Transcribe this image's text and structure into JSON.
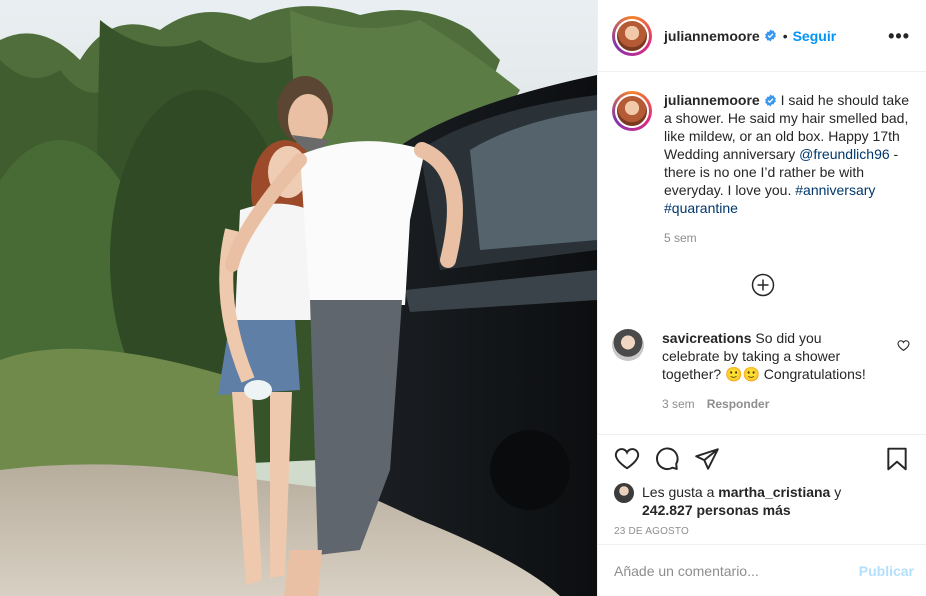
{
  "header": {
    "username": "juliannemoore",
    "separator": "•",
    "follow_label": "Seguir",
    "more_label": "•••"
  },
  "caption": {
    "username": "juliannemoore",
    "text_before": "I said he should take a shower. He said my hair smelled bad, like mildew, or an old box. Happy 17th Wedding anniversary ",
    "mention": "@freundlich96",
    "text_after": " - there is no one I’d rather be with everyday. I love you. ",
    "hashtag1": "#anniversary",
    "hashtag2": "#quarantine",
    "time": "5 sem"
  },
  "comment": {
    "username": "savicreations",
    "text": "So did you celebrate by taking a shower together? 🙂🙂 Congratulations!",
    "time": "3 sem",
    "reply_label": "Responder"
  },
  "likes": {
    "prefix": "Les gusta a ",
    "user": "martha_cristiana",
    "conj": " y",
    "count": "242.827 personas más"
  },
  "date": "23 DE AGOSTO",
  "add_comment": {
    "placeholder": "Añade un comentario...",
    "publish_label": "Publicar"
  },
  "icons": {
    "verified": "verified-badge-icon",
    "load_more": "plus-circle-icon",
    "like": "heart-icon",
    "comment": "comment-bubble-icon",
    "share": "paper-plane-icon",
    "save": "bookmark-icon"
  },
  "colors": {
    "accent": "#0095f6",
    "link": "#00376b",
    "muted": "#8e8e8e",
    "publish_disabled": "#b2dffc"
  }
}
